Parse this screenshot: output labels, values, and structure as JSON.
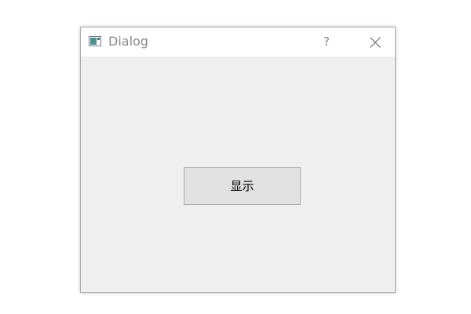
{
  "window": {
    "title": "Dialog",
    "help_label": "?",
    "icon": "application-window-icon",
    "close_icon": "close-icon"
  },
  "main": {
    "show_button_label": "显示"
  },
  "colors": {
    "titlebar_bg": "#ffffff",
    "content_bg": "#efefef",
    "button_bg": "#e1e1e1",
    "button_border": "#adadad",
    "title_text": "#888888"
  }
}
